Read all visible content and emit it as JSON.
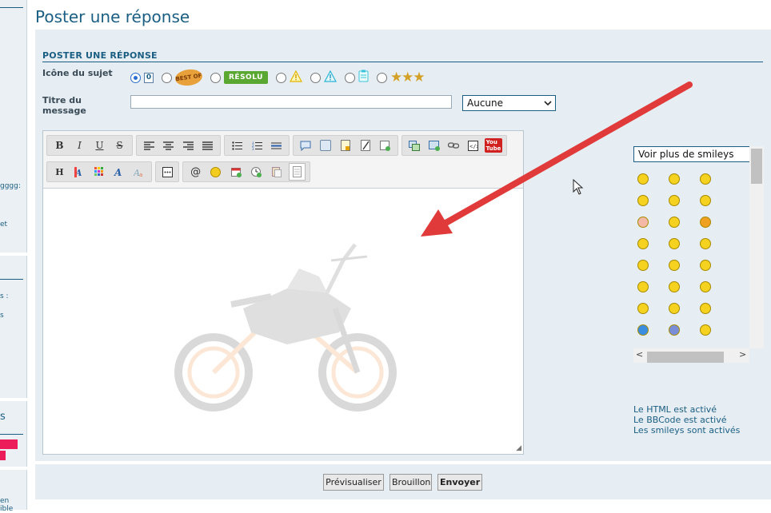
{
  "page": {
    "title": "Poster une réponse"
  },
  "sidebar": {
    "fragments": [
      "gggg:",
      "et",
      "s :",
      "s",
      "s",
      "en",
      "ible"
    ]
  },
  "form": {
    "section_title": "POSTER UNE RÉPONSE",
    "subject_icon_label": "Icône du sujet",
    "title_label_line1": "Titre du",
    "title_label_line2": "message",
    "title_value": "",
    "prefix_select": {
      "selected": "Aucune"
    },
    "icons": [
      {
        "name": "zero-icon",
        "selected": true,
        "text": "0"
      },
      {
        "name": "best-of-icon",
        "selected": false,
        "text": "BEST OF"
      },
      {
        "name": "resolu-badge",
        "selected": false,
        "text": "RÉSOLU"
      },
      {
        "name": "warning-yellow-icon",
        "selected": false
      },
      {
        "name": "warning-blue-icon",
        "selected": false
      },
      {
        "name": "clipboard-icon",
        "selected": false
      },
      {
        "name": "three-stars-icon",
        "selected": false
      }
    ]
  },
  "editor": {
    "toolbar_row1": [
      {
        "group": [
          "B",
          "I",
          "U",
          "S"
        ]
      },
      {
        "group": [
          "align-left-icon",
          "align-center-icon",
          "align-right-icon",
          "justify-icon"
        ]
      },
      {
        "group": [
          "bullet-list-icon",
          "numbered-list-icon",
          "horizontal-rule-icon"
        ]
      },
      {
        "group": [
          "quote-icon",
          "image-icon",
          "spoiler-icon",
          "edit-icon",
          "table-icon"
        ]
      },
      {
        "group": [
          "upload-image-icon",
          "insert-image-icon",
          "link-icon",
          "code-icon",
          "youtube-icon"
        ]
      }
    ],
    "toolbar_row2": [
      {
        "group": [
          "H",
          "font-color-icon",
          "color-palette-icon",
          "font-family-icon",
          "font-size-icon"
        ]
      },
      {
        "group": [
          "more-icon"
        ]
      },
      {
        "group": [
          "@",
          "smiley-icon",
          "calendar-icon",
          "clock-icon",
          "paste-icon",
          "source-icon"
        ]
      }
    ],
    "youtube_label": "You Tube",
    "content": ""
  },
  "smileys": {
    "select_label": "Voir plus de smileys",
    "count_visible": 24
  },
  "status": {
    "html": "Le HTML est activé",
    "bbcode": "Le BBCode est activé",
    "smileys": "Les smileys sont activés"
  },
  "buttons": {
    "preview": "Prévisualiser",
    "draft": "Brouillon",
    "send": "Envoyer"
  },
  "colors": {
    "accent": "#1b5e83",
    "panel_bg": "#e6eef3",
    "annotation_arrow": "#e03a3a",
    "resolu_green": "#5aa832"
  }
}
